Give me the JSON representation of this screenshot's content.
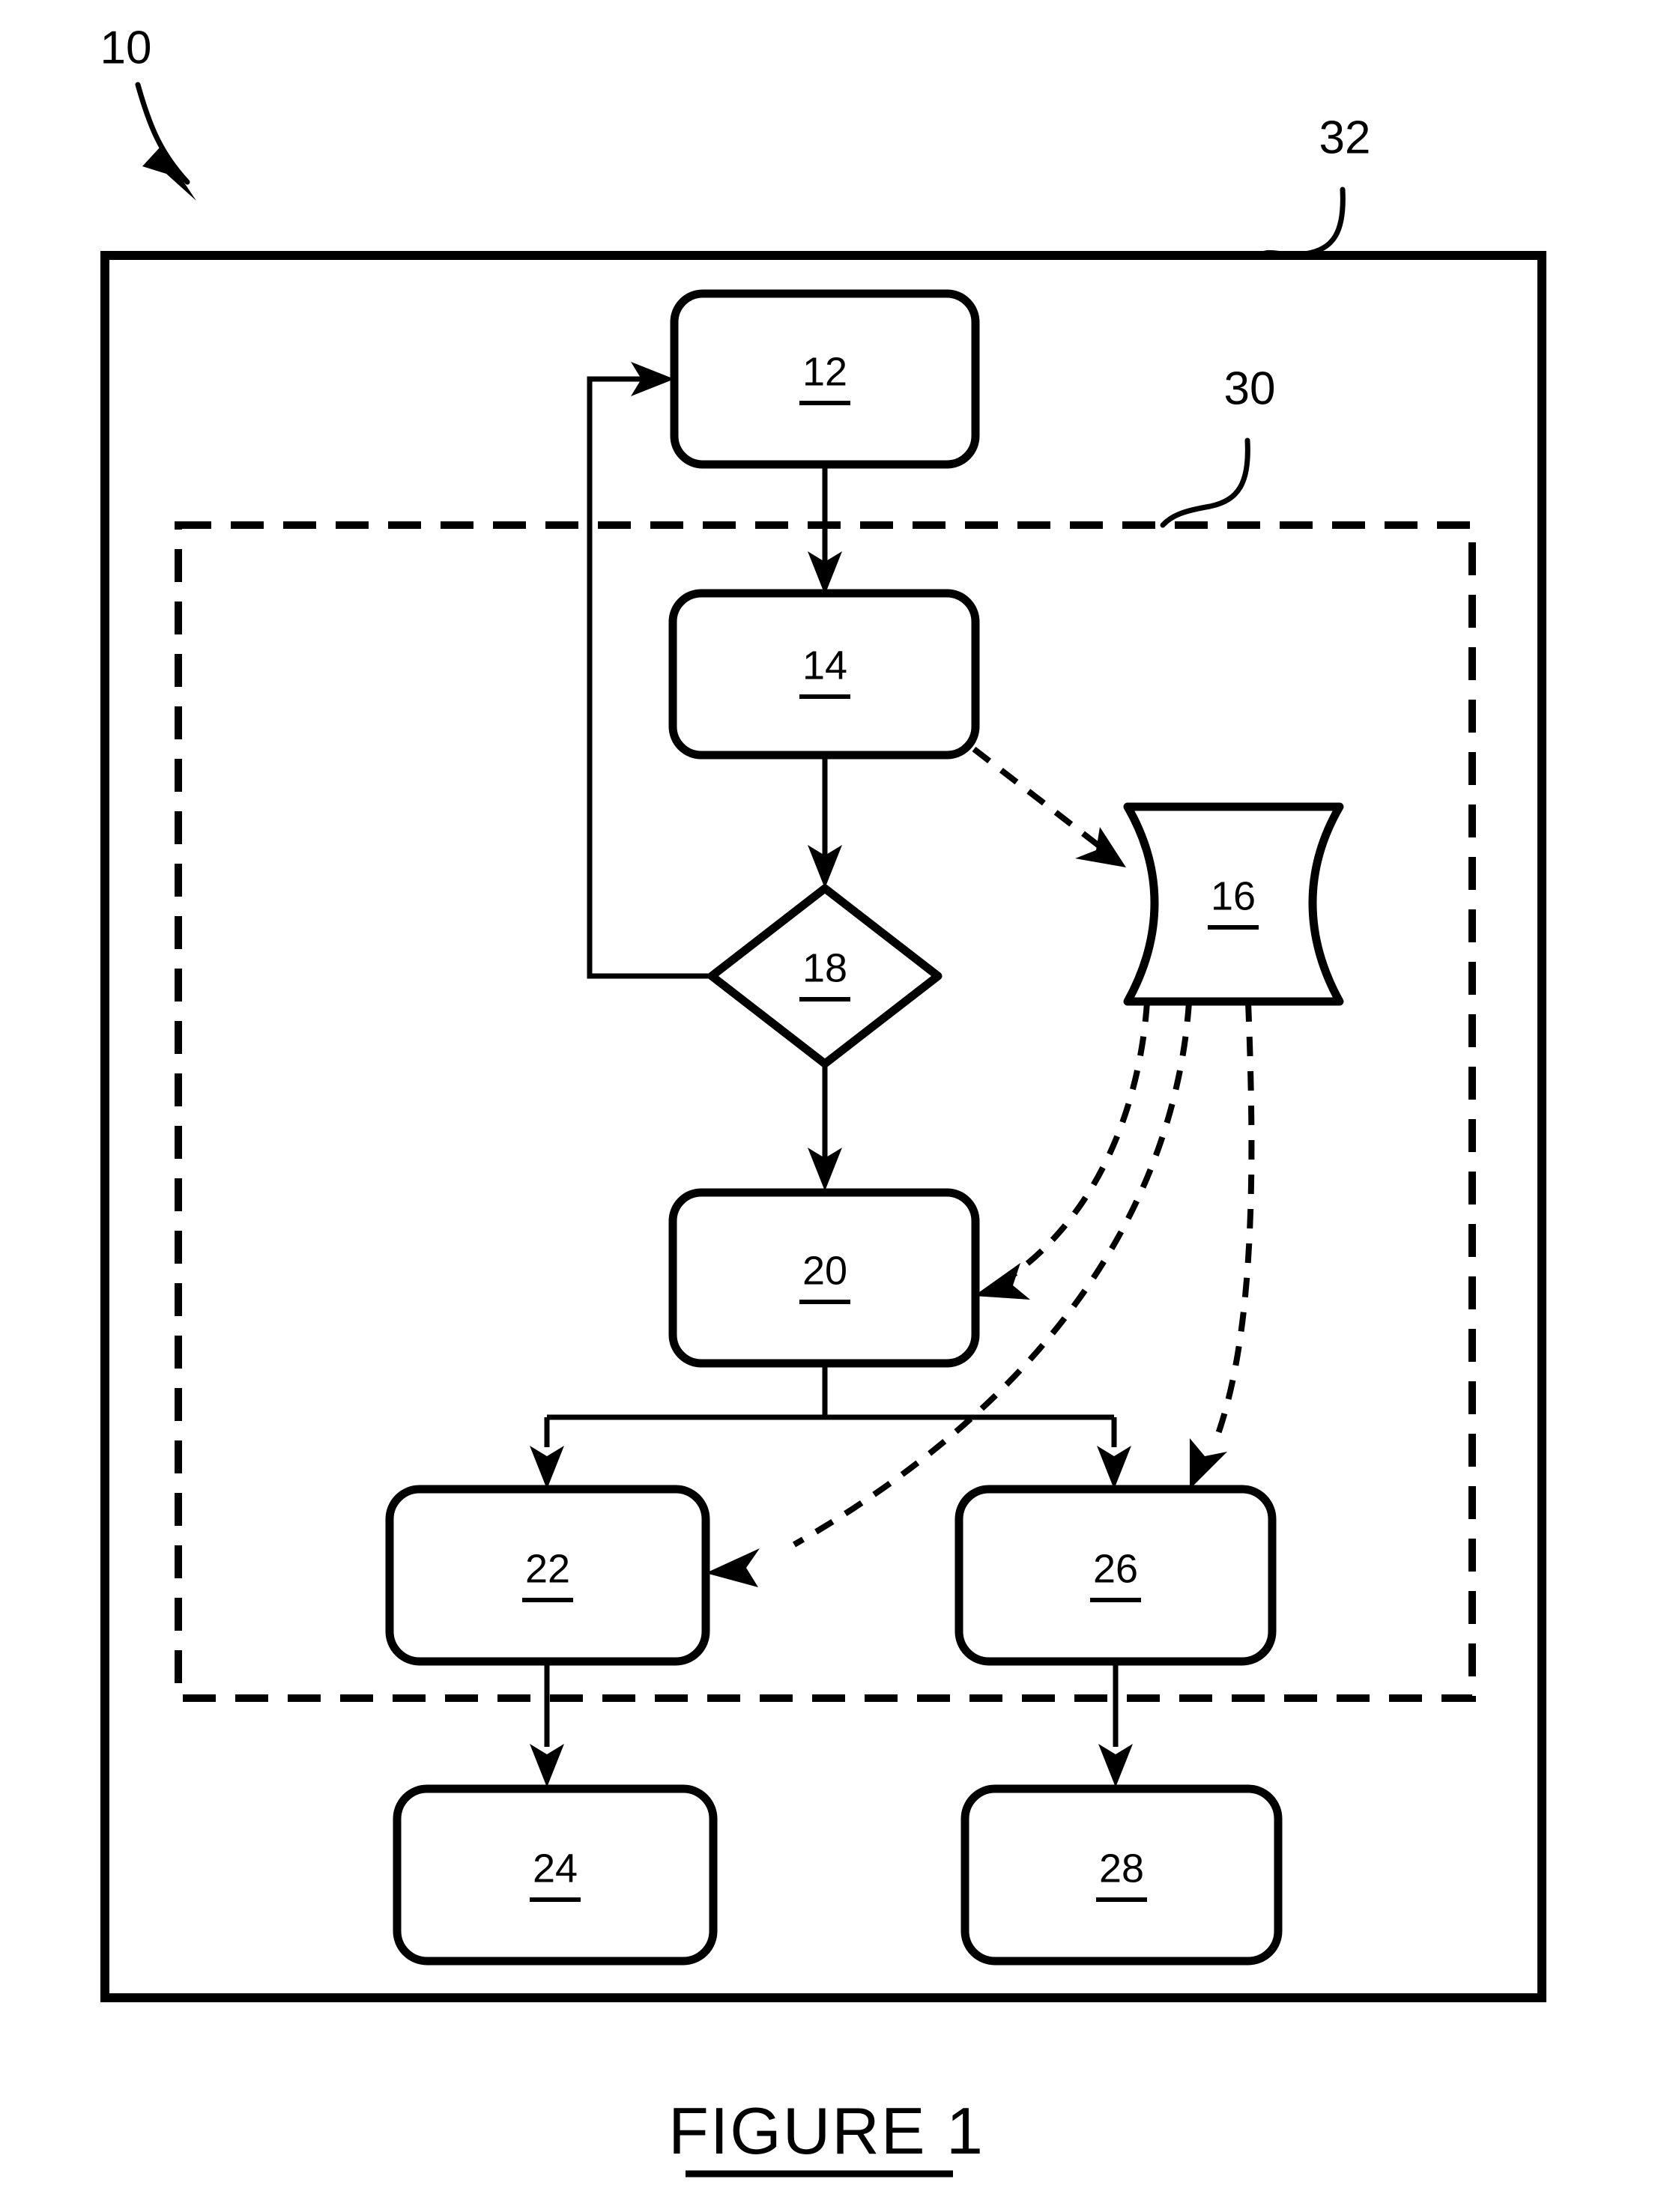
{
  "figure": {
    "caption": "FIGURE  1",
    "caption_underline": true
  },
  "reference_numerals": {
    "system": "10",
    "outer_boundary": "32",
    "inner_boundary": "30"
  },
  "nodes": [
    {
      "id": "n12",
      "label": "12",
      "shape": "rounded-rectangle",
      "underlined": true
    },
    {
      "id": "n14",
      "label": "14",
      "shape": "rounded-rectangle",
      "underlined": true
    },
    {
      "id": "n16",
      "label": "16",
      "shape": "curved-data-store",
      "underlined": true
    },
    {
      "id": "n18",
      "label": "18",
      "shape": "diamond-decision",
      "underlined": true
    },
    {
      "id": "n20",
      "label": "20",
      "shape": "rounded-rectangle",
      "underlined": true
    },
    {
      "id": "n22",
      "label": "22",
      "shape": "rounded-rectangle",
      "underlined": true
    },
    {
      "id": "n24",
      "label": "24",
      "shape": "rounded-rectangle",
      "underlined": true
    },
    {
      "id": "n26",
      "label": "26",
      "shape": "rounded-rectangle",
      "underlined": true
    },
    {
      "id": "n28",
      "label": "28",
      "shape": "rounded-rectangle",
      "underlined": true
    }
  ],
  "connections": [
    {
      "from": "12",
      "to": "14",
      "style": "solid",
      "arrow": true
    },
    {
      "from": "14",
      "to": "18",
      "style": "solid",
      "arrow": true
    },
    {
      "from": "14",
      "to": "16",
      "style": "dashed",
      "arrow": true
    },
    {
      "from": "18",
      "to": "12",
      "style": "solid",
      "arrow": true,
      "note": "feedback loop to left then up"
    },
    {
      "from": "18",
      "to": "20",
      "style": "solid",
      "arrow": true
    },
    {
      "from": "16",
      "to": "20",
      "style": "dashed",
      "arrow": true
    },
    {
      "from": "16",
      "to": "22",
      "style": "dashed",
      "arrow": true
    },
    {
      "from": "16",
      "to": "26",
      "style": "dashed",
      "arrow": true
    },
    {
      "from": "20",
      "to": "22",
      "style": "solid",
      "arrow": true
    },
    {
      "from": "20",
      "to": "26",
      "style": "solid",
      "arrow": true
    },
    {
      "from": "22",
      "to": "24",
      "style": "solid",
      "arrow": true
    },
    {
      "from": "26",
      "to": "28",
      "style": "solid",
      "arrow": true
    }
  ],
  "colors": {
    "stroke": "#000000",
    "background": "#ffffff"
  }
}
